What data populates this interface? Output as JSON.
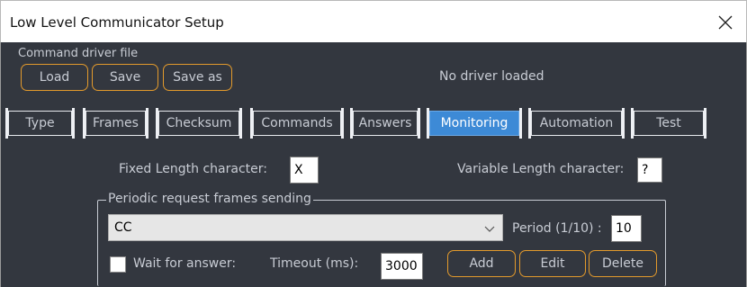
{
  "window": {
    "title": "Low Level Communicator Setup",
    "close_icon": "close-icon"
  },
  "driver": {
    "section_label": "Command driver file",
    "load_label": "Load",
    "save_label": "Save",
    "save_as_label": "Save as",
    "status": "No driver loaded"
  },
  "tabs": [
    {
      "label": "Type",
      "active": false
    },
    {
      "label": "Frames",
      "active": false
    },
    {
      "label": "Checksum",
      "active": false
    },
    {
      "label": "Commands",
      "active": false
    },
    {
      "label": "Answers",
      "active": false
    },
    {
      "label": "Monitoring",
      "active": true
    },
    {
      "label": "Automation",
      "active": false
    },
    {
      "label": "Test",
      "active": false
    }
  ],
  "monitoring": {
    "fixed_length_label": "Fixed Length character:",
    "fixed_length_value": "X",
    "variable_length_label": "Variable Length character:",
    "variable_length_value": "?",
    "periodic_group_title": "Periodic request frames sending",
    "frame_selected": "CC",
    "period_label": "Period (1/10) :",
    "period_value": "10",
    "wait_for_answer_label": "Wait for answer:",
    "wait_for_answer_checked": false,
    "timeout_label": "Timeout (ms):",
    "timeout_value": "3000",
    "add_label": "Add",
    "edit_label": "Edit",
    "delete_label": "Delete"
  },
  "colors": {
    "panel_bg": "#33373f",
    "accent_orange": "#e39a2c",
    "active_tab": "#3d8ad6",
    "text": "#c8ccd4"
  }
}
